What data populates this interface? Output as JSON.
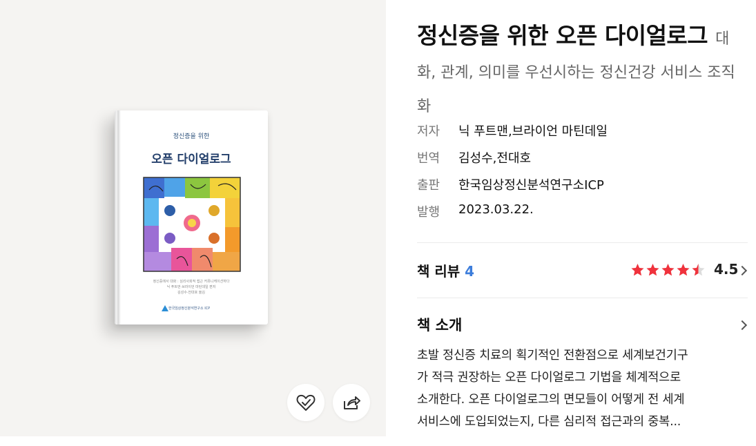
{
  "book": {
    "title_main": "정신증을 위한 오픈 다이얼로그",
    "subtitle": "대화, 관계, 의미를 우선시하는 정신건강 서비스 조직화",
    "cover": {
      "small_title": "정신증을 위한",
      "big_title": "오픈 다이얼로그",
      "credits": [
        "정신증에서 대화 : 심리사회적 접근 커뮤니케이션하다",
        "닉 푸트먼·브라이언 마틴데일 편저",
        "김성수·전대호 옮김"
      ],
      "publisher_mark": "한국임상정신분석연구소 ICP"
    }
  },
  "meta": [
    {
      "label": "저자",
      "value": "닉 푸트맨,브라이언 마틴데일"
    },
    {
      "label": "번역",
      "value": "김성수,전대호"
    },
    {
      "label": "출판",
      "value": "한국임상정신분석연구소ICP"
    },
    {
      "label": "발행",
      "value": "2023.03.22."
    }
  ],
  "review": {
    "label": "책 리뷰",
    "count": "4",
    "rating": "4.5",
    "rating_value": 4.5,
    "star_color": "#f0323c"
  },
  "intro": {
    "label": "책 소개",
    "lines": [
      "초발 정신증 치료의 획기적인 전환점으로 세계보건기구",
      "가 적극 권장하는 오픈 다이얼로그 기법을 체계적으로",
      "소개한다. 오픈 다이얼로그의 면모들이 어떻게 전 세계",
      "서비스에 도입되었는지, 다른 심리적 접근과의 중복..."
    ]
  },
  "actions": {
    "like_icon": "heart-check-icon",
    "share_icon": "share-icon"
  }
}
